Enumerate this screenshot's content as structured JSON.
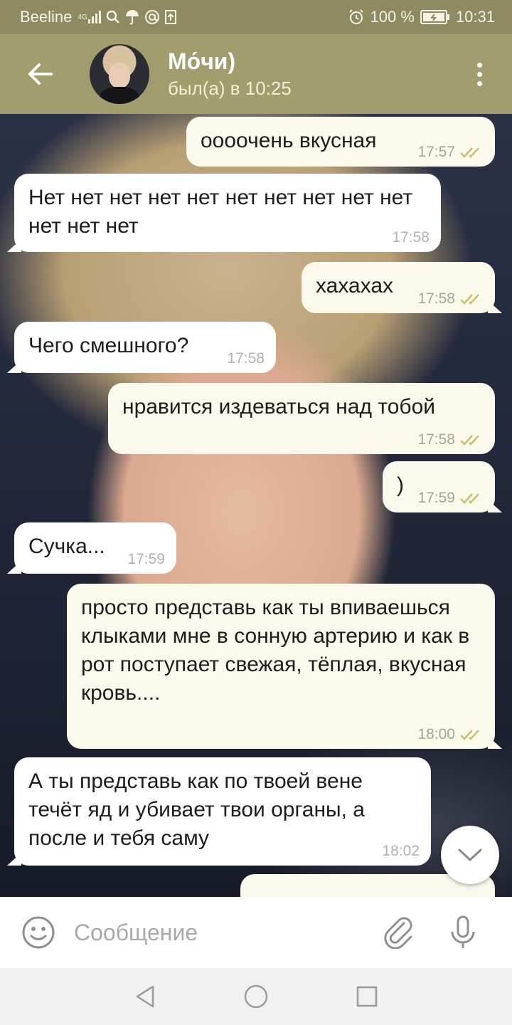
{
  "status_bar": {
    "carrier": "Beeline",
    "network_type": "4G",
    "battery": "100 %",
    "time": "10:31"
  },
  "header": {
    "contact_name": "Мо́чи)",
    "contact_status": "был(а) в 10:25"
  },
  "messages": [
    {
      "direction": "out",
      "text": "оооочень вкусная",
      "time": "17:57",
      "read": true
    },
    {
      "direction": "in",
      "text": "Нет нет нет нет нет нет нет нет нет нет нет нет нет",
      "time": "17:58"
    },
    {
      "direction": "out",
      "text": "хахахах",
      "time": "17:58",
      "read": true
    },
    {
      "direction": "in",
      "text": "Чего смешного?",
      "time": "17:58"
    },
    {
      "direction": "out",
      "text": "нравится издеваться над тобой",
      "time": "17:58",
      "read": true
    },
    {
      "direction": "out",
      "text": ")",
      "time": "17:59",
      "read": true
    },
    {
      "direction": "in",
      "text": "Сучка...",
      "time": "17:59"
    },
    {
      "direction": "out",
      "text": "просто представь как ты впиваешься клыками мне в сонную артерию и как в рот поступает свежая, тёплая, вкусная кровь....",
      "time": "18:00",
      "read": true
    },
    {
      "direction": "in",
      "text": "А ты представь как по твоей вене течёт яд и убивает твои органы, а после и тебя саму",
      "time": "18:02"
    }
  ],
  "input": {
    "placeholder": "Сообщение"
  },
  "colors": {
    "header": "#a29d6d",
    "status_bar": "#8e8a62",
    "outgoing_bubble": "#fbf8ec",
    "incoming_bubble": "#ffffff",
    "read_check": "#c9bf6e"
  },
  "icons": {
    "back": "arrow-left-icon",
    "menu": "more-vert-icon",
    "emoji": "smiley-icon",
    "attach": "paperclip-icon",
    "mic": "microphone-icon",
    "scroll": "chevron-down-icon"
  }
}
